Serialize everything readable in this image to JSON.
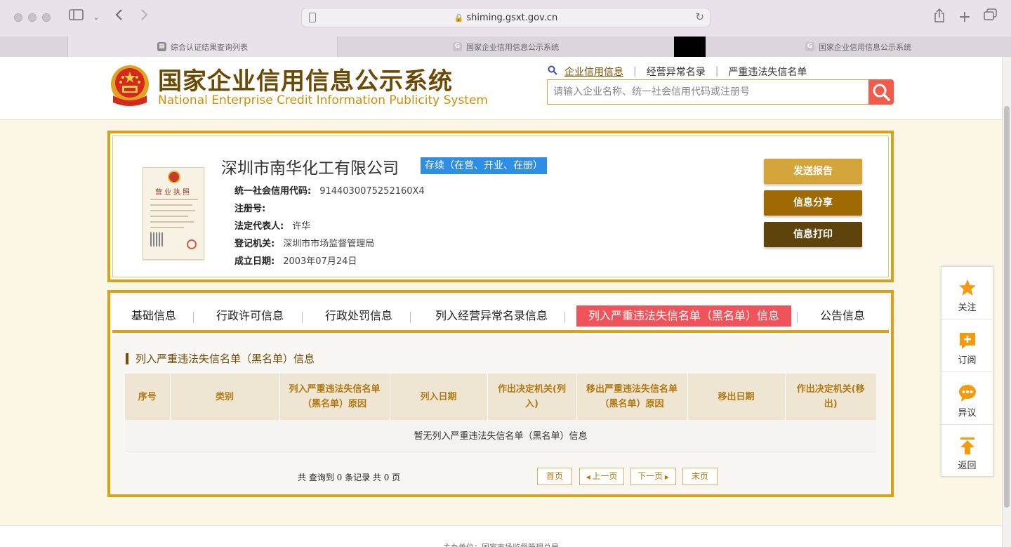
{
  "browser": {
    "url": "shiming.gsxt.gov.cn",
    "tabs": [
      {
        "label": "综合认证结果查询列表"
      },
      {
        "label": "国家企业信用信息公示系统"
      },
      {
        "label": "国家企业信用信息公示系统"
      }
    ]
  },
  "header": {
    "title_cn": "国家企业信用信息公示系统",
    "title_en": "National Enterprise Credit Information Publicity System",
    "nav": [
      "企业信用信息",
      "经营异常名录",
      "严重违法失信名单"
    ],
    "search_placeholder": "请输入企业名称、统一社会信用代码或注册号"
  },
  "company": {
    "license_title": "营业执照",
    "name": "深圳市南华化工有限公司",
    "status": "存续（在营、开业、在册）",
    "fields": [
      {
        "label": "统一社会信用代码:",
        "value": "9144030075252160X4"
      },
      {
        "label": "注册号:",
        "value": ""
      },
      {
        "label": "法定代表人:",
        "value": "许华"
      },
      {
        "label": "登记机关:",
        "value": "深圳市市场监督管理局"
      },
      {
        "label": "成立日期:",
        "value": "2003年07月24日"
      }
    ],
    "actions": {
      "send": "发送报告",
      "share": "信息分享",
      "print": "信息打印"
    },
    "colors": {
      "send": "#d4a53a",
      "share": "#a06a03",
      "print": "#5f430d"
    }
  },
  "tabs": {
    "items": [
      "基础信息",
      "行政许可信息",
      "行政处罚信息",
      "列入经营异常名录信息",
      "列入严重违法失信名单（黑名单）信息",
      "公告信息"
    ],
    "active_index": 4
  },
  "section": {
    "title": "列入严重违法失信名单（黑名单）信息",
    "columns": [
      "序号",
      "类别",
      "列入严重违法失信名单（黑名单）原因",
      "列入日期",
      "作出决定机关(列入)",
      "移出严重违法失信名单（黑名单）原因",
      "移出日期",
      "作出决定机关(移出)"
    ],
    "empty_message": "暂无列入严重违法失信名单（黑名单）信息",
    "record_count": "共 查询到 0 条记录 共 0 页",
    "pager": {
      "first": "首页",
      "prev": "上一页",
      "next": "下一页",
      "last": "末页"
    }
  },
  "side_panel": [
    {
      "label": "关注",
      "icon": "star-icon"
    },
    {
      "label": "订阅",
      "icon": "subscribe-icon"
    },
    {
      "label": "异议",
      "icon": "chat-icon"
    },
    {
      "label": "返回",
      "icon": "back-to-top-icon"
    }
  ],
  "footer": {
    "text": "主办单位：国家市场监督管理总局"
  },
  "theme": {
    "gold": "#d6a21c",
    "brown": "#6b4a06",
    "red": "#f0545a",
    "blue": "#2e8ee6",
    "search_red": "#f35a4a"
  }
}
